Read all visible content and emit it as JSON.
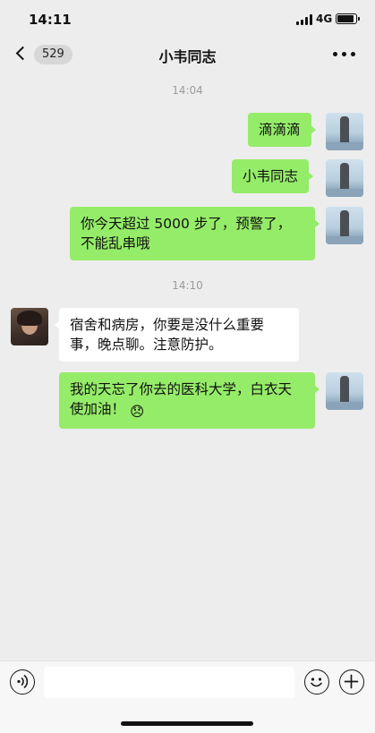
{
  "status_bar": {
    "time": "14:11",
    "network": "4G"
  },
  "nav": {
    "unread_count": "529",
    "title": "小韦同志"
  },
  "messages": [
    {
      "timestamp": "14:04"
    },
    {
      "text": "滴滴滴"
    },
    {
      "text": "小韦同志"
    },
    {
      "text": "你今天超过 5000 步了，预警了，不能乱串哦"
    },
    {
      "timestamp": "14:10"
    },
    {
      "text": "宿舍和病房，你要是没什么重要事，晚点聊。注意防护。"
    },
    {
      "text": "我的天忘了你去的医科大学，白衣天使加油！"
    }
  ],
  "icons": {
    "back": "chevron-left-icon",
    "more": "more-dots-icon",
    "voice": "voice-icon",
    "emoji": "smile-icon",
    "add": "plus-icon",
    "inline_emoji": "😞"
  },
  "colors": {
    "sent_bubble": "#95ec69",
    "received_bubble": "#ffffff",
    "background": "#ededed"
  }
}
